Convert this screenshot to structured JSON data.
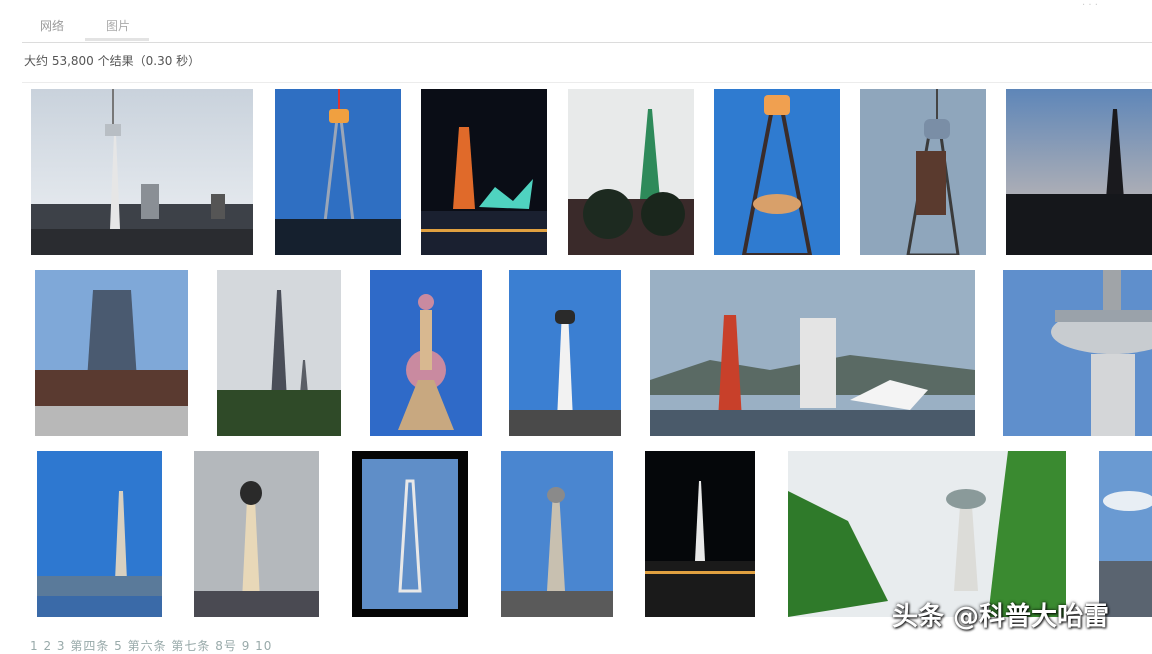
{
  "tabs": [
    {
      "label": "网络"
    },
    {
      "label": "图片"
    }
  ],
  "results_summary": "大约 53,800 个结果（0.30 秒）",
  "top_right_text": "· · ·",
  "pagination": [
    "1",
    "2",
    "3",
    "第四条",
    "5",
    "第六条",
    "第七条",
    "8号",
    "9",
    "10"
  ],
  "pagination_text": "1 2 3 第四条 5 第六条 第七条 8号 9 10",
  "watermark": "头条 @科普大咍雷",
  "thumbnails": [
    {
      "subject": "tv-tower-cloudy-sky"
    },
    {
      "subject": "lit-lattice-tower-blue"
    },
    {
      "subject": "kobe-port-tower-night"
    },
    {
      "subject": "green-lattice-tower"
    },
    {
      "subject": "lattice-tower-closeup-blue"
    },
    {
      "subject": "tower-with-billboard"
    },
    {
      "subject": "tower-silhouette-dusk"
    },
    {
      "subject": "skyscraper-plaza"
    },
    {
      "subject": "twin-antenna-towers"
    },
    {
      "subject": "oriental-pearl-tower"
    },
    {
      "subject": "tall-white-tv-tower"
    },
    {
      "subject": "kobe-harbor-panorama"
    },
    {
      "subject": "observation-deck-closeup"
    },
    {
      "subject": "slender-tv-tower-waterfront"
    },
    {
      "subject": "grey-tv-tower"
    },
    {
      "subject": "framed-lattice-tower"
    },
    {
      "subject": "tv-tower-street"
    },
    {
      "subject": "illuminated-tower-night"
    },
    {
      "subject": "tower-over-green-trees"
    },
    {
      "subject": "cropped-city-sky"
    }
  ]
}
